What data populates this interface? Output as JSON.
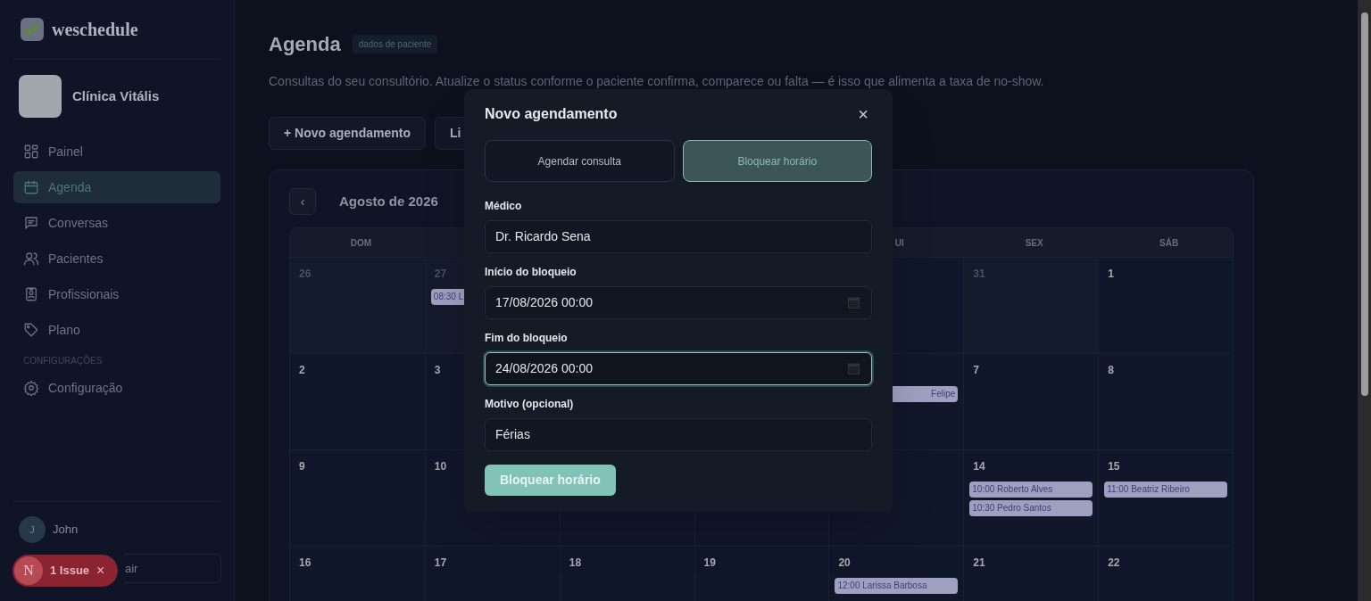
{
  "sidebar": {
    "brand": "weschedule",
    "clinic": {
      "name": "Clínica Vitális"
    },
    "items": [
      {
        "label": "Painel",
        "selected": false
      },
      {
        "label": "Agenda",
        "selected": true
      },
      {
        "label": "Conversas",
        "selected": false
      },
      {
        "label": "Pacientes",
        "selected": false
      },
      {
        "label": "Profissionais",
        "selected": false
      },
      {
        "label": "Plano",
        "selected": false
      }
    ],
    "section_label": "CONFIGURAÇÕES",
    "settings_items": [
      {
        "label": "Configuração",
        "selected": false
      }
    ],
    "user": {
      "initial": "J",
      "name": "John"
    },
    "logout_button": "air"
  },
  "issue_badge": {
    "logo": "N",
    "label": "1 Issue",
    "close": "×"
  },
  "page": {
    "title": "Agenda",
    "tag": "dados de paciente",
    "description": "Consultas do seu consultório. Atualize o status conforme o paciente confirma, comparece ou falta — é isso que alimenta a taxa de no-show.",
    "actions": [
      "+ Novo agendamento",
      "Li"
    ]
  },
  "calendar": {
    "prev": "‹",
    "month": "Agosto de 2026",
    "weekdays": [
      "DOM",
      "UI",
      "SEX",
      "SÁB"
    ],
    "weeks": [
      [
        {
          "day": "26",
          "outside_month": true
        },
        {
          "day": "27",
          "outside_month": true,
          "events": [
            "08:30 L"
          ]
        },
        {
          "day": "31",
          "outside_month": true
        },
        {
          "day": "1",
          "outside_month": false
        }
      ],
      [
        {
          "day": "2",
          "outside_month": false
        },
        {
          "day": "3",
          "outside_month": false
        },
        {
          "events": [
            "Felipe"
          ]
        },
        {
          "day": "7",
          "outside_month": false
        },
        {
          "day": "8",
          "outside_month": false
        }
      ],
      [
        {
          "day": "9",
          "outside_month": false
        },
        {
          "day": "10",
          "outside_month": false
        },
        {
          "day": "14",
          "outside_month": false,
          "events": [
            "10:00 Roberto Alves",
            "10:30 Pedro Santos"
          ]
        },
        {
          "day": "15",
          "outside_month": false,
          "events": [
            "11:00 Beatriz Ribeiro"
          ]
        }
      ],
      [
        {
          "day": "16",
          "outside_month": false
        },
        {
          "day": "17",
          "outside_month": false
        },
        {
          "day": "18",
          "outside_month": false
        },
        {
          "day": "19",
          "outside_month": false
        },
        {
          "day": "20",
          "outside_month": false,
          "events": [
            "12:00 Larissa Barbosa"
          ]
        },
        {
          "day": "21",
          "outside_month": false
        },
        {
          "day": "22",
          "outside_month": false
        }
      ]
    ]
  },
  "modal": {
    "title": "Novo agendamento",
    "close": "×",
    "tabs": [
      {
        "label": "Agendar consulta",
        "selected": false
      },
      {
        "label": "Bloquear horário",
        "selected": true
      }
    ],
    "fields": [
      {
        "label": "Médico",
        "kind": "text",
        "value": "Dr. Ricardo Sena",
        "focused": false
      },
      {
        "label": "Início do bloqueio",
        "kind": "datetime",
        "value": "17/08/2026 00:00",
        "focused": false
      },
      {
        "label": "Fim do bloqueio",
        "kind": "datetime",
        "value": "24/08/2026 00:00",
        "focused": true
      },
      {
        "label": "Motivo (opcional)",
        "kind": "text",
        "value": "Férias",
        "focused": false
      }
    ],
    "submit": "Bloquear horário"
  }
}
